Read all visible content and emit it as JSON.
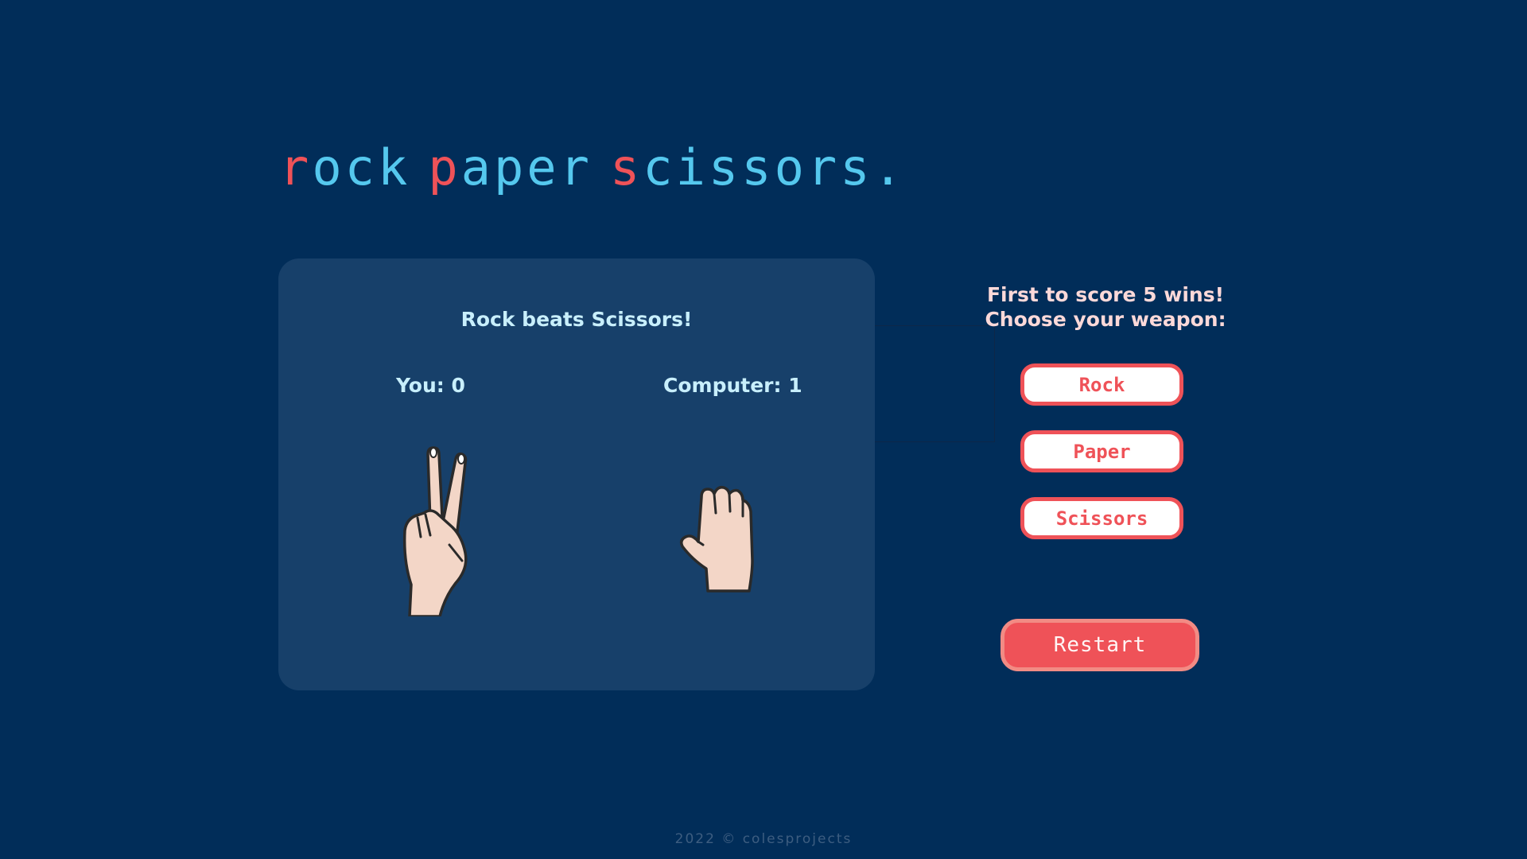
{
  "title": {
    "part1_accent": "r",
    "part1_rest": "ock",
    "part2_accent": "p",
    "part2_rest": "aper",
    "part3_accent": "s",
    "part3_rest": "cissors",
    "dot": "."
  },
  "board": {
    "result": "Rock beats Scissors!",
    "player_score": "You: 0",
    "computer_score": "Computer: 1",
    "player_hand": "scissors-hand-icon",
    "computer_hand": "rock-fist-icon"
  },
  "controls": {
    "instruction_line1": "First to score 5 wins!",
    "instruction_line2": "Choose your weapon:",
    "rock_label": "Rock",
    "paper_label": "Paper",
    "scissors_label": "Scissors",
    "restart_label": "Restart"
  },
  "footer": {
    "text": "2022 © colesprojects"
  },
  "colors": {
    "background": "#012d59",
    "board": "#17406a",
    "accent": "#ef5258",
    "title": "#55c8ee"
  }
}
